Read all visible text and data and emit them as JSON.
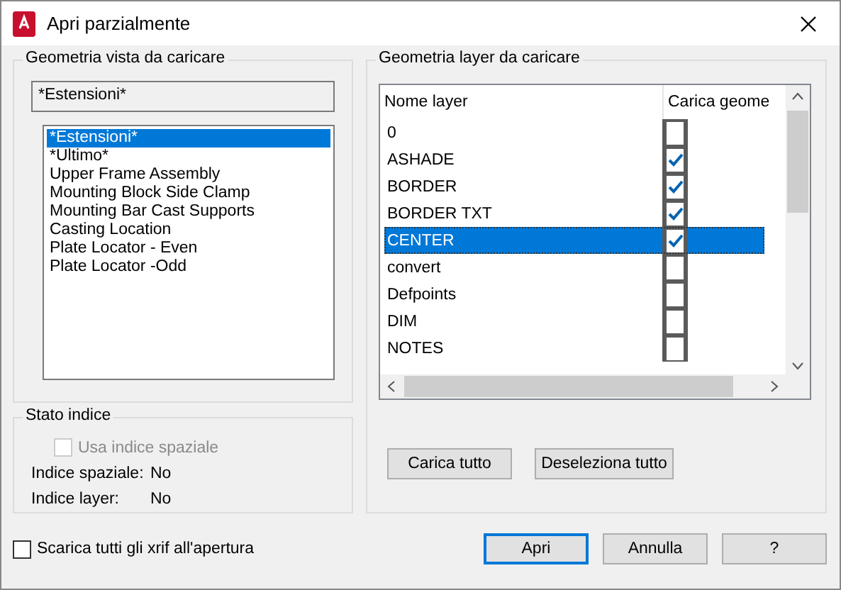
{
  "window": {
    "title": "Apri parzialmente"
  },
  "view_group": {
    "title": "Geometria vista da caricare",
    "current": "*Estensioni*",
    "views": [
      {
        "label": "*Estensioni*",
        "selected": true
      },
      {
        "label": "*Ultimo*",
        "selected": false
      },
      {
        "label": "Upper Frame Assembly",
        "selected": false
      },
      {
        "label": "Mounting Block Side Clamp",
        "selected": false
      },
      {
        "label": "Mounting Bar Cast Supports",
        "selected": false
      },
      {
        "label": "Casting Location",
        "selected": false
      },
      {
        "label": "Plate Locator - Even",
        "selected": false
      },
      {
        "label": "Plate Locator -Odd",
        "selected": false
      }
    ]
  },
  "index_group": {
    "title": "Stato indice",
    "use_spatial": {
      "label": "Usa indice spaziale",
      "checked": false,
      "disabled": true
    },
    "rows": [
      {
        "label": "Indice spaziale:",
        "value": "No"
      },
      {
        "label": "Indice layer:",
        "value": "No"
      }
    ]
  },
  "layer_group": {
    "title": "Geometria layer da caricare",
    "columns": [
      "Nome layer",
      "Carica geome"
    ],
    "layers": [
      {
        "name": "0",
        "checked": false,
        "selected": false
      },
      {
        "name": "ASHADE",
        "checked": true,
        "selected": false
      },
      {
        "name": "BORDER",
        "checked": true,
        "selected": false
      },
      {
        "name": "BORDER TXT",
        "checked": true,
        "selected": false
      },
      {
        "name": "CENTER",
        "checked": true,
        "selected": true
      },
      {
        "name": "convert",
        "checked": false,
        "selected": false
      },
      {
        "name": "Defpoints",
        "checked": false,
        "selected": false
      },
      {
        "name": "DIM",
        "checked": false,
        "selected": false
      },
      {
        "name": "NOTES",
        "checked": false,
        "selected": false
      }
    ],
    "buttons": [
      "Carica tutto",
      "Deseleziona tutto"
    ]
  },
  "unload_xrefs": {
    "label": "Scarica tutti gli xrif all'apertura",
    "checked": false
  },
  "buttons": [
    {
      "label": "Apri",
      "default": true
    },
    {
      "label": "Annulla",
      "default": false
    },
    {
      "label": "?",
      "default": false
    }
  ]
}
